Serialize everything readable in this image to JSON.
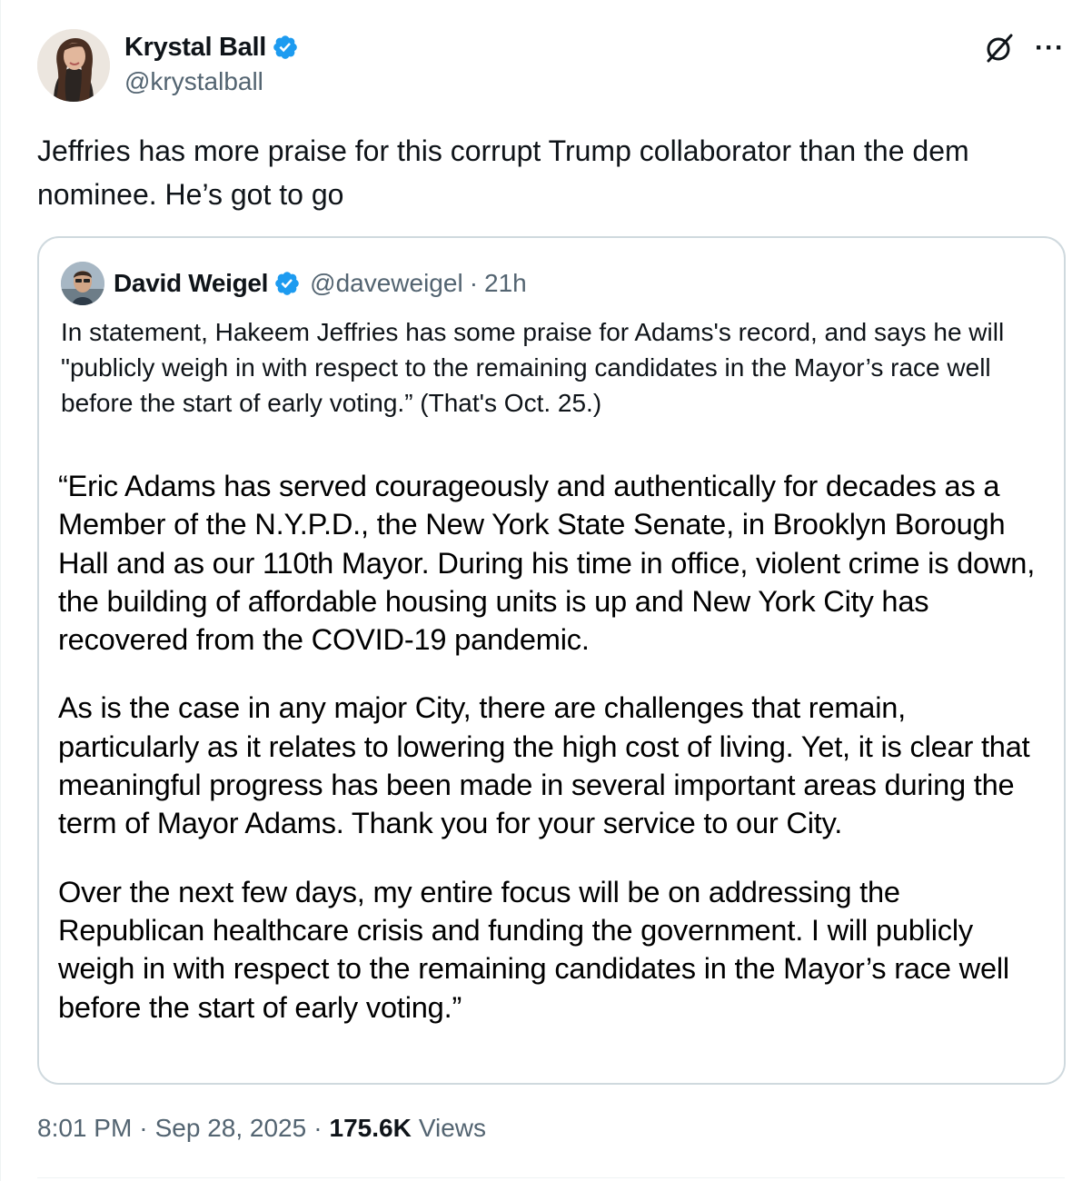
{
  "author": {
    "display_name": "Krystal Ball",
    "handle": "@krystalball",
    "verified": true,
    "verified_color": "#1d9bf0"
  },
  "icons": {
    "verified": "verified-badge-icon",
    "grok": "grok-slash-icon",
    "more": "more-options-icon",
    "more_glyph": "···"
  },
  "tweet": {
    "text": "Jeffries has more praise for this corrupt Trump collaborator than the dem nominee. He’s got to go"
  },
  "quoted_tweet": {
    "display_name": "David Weigel",
    "handle": "@daveweigel",
    "separator": "·",
    "time": "21h",
    "text": "In statement, Hakeem Jeffries has some praise for Adams's record, and says he will \"publicly weigh in with respect to the remaining candidates in the Mayor’s race well before the start of early voting.” (That's Oct. 25.)",
    "statement_image": {
      "paragraphs": [
        "“Eric Adams has served courageously and authentically for decades as a Member of the N.Y.P.D., the New York State Senate, in Brooklyn Borough Hall and as our 110th Mayor. During his time in office, violent crime is down, the building of affordable housing units is up and New York City has recovered from the COVID-19 pandemic.",
        "As is the case in any major City, there are challenges that remain, particularly as it relates to lowering the high cost of living. Yet, it is clear that meaningful progress has been made in several important areas during the term of Mayor Adams. Thank you for your service to our City.",
        "Over the next few days, my entire focus will be on addressing the Republican healthcare crisis and funding the government. I will publicly weigh in with respect to the remaining candidates in the Mayor’s race well before the start of early voting.”"
      ]
    }
  },
  "footer": {
    "time": "8:01 PM",
    "separator": "·",
    "date": "Sep 28, 2025",
    "views_count": "175.6K",
    "views_label": "Views"
  },
  "colors": {
    "text_primary": "#0f1419",
    "text_secondary": "#536471",
    "border": "#cfd9de",
    "accent": "#1d9bf0"
  }
}
